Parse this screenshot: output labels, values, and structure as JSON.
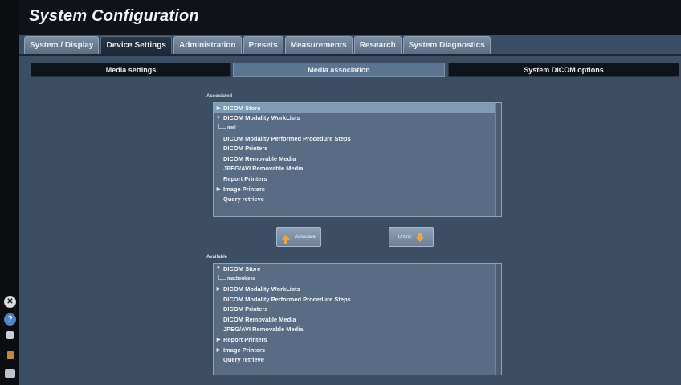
{
  "window": {
    "title": "System Configuration"
  },
  "tabs": [
    {
      "label": "System / Display",
      "active": false
    },
    {
      "label": "Device Settings",
      "active": true
    },
    {
      "label": "Administration",
      "active": false
    },
    {
      "label": "Presets",
      "active": false
    },
    {
      "label": "Measurements",
      "active": false
    },
    {
      "label": "Research",
      "active": false
    },
    {
      "label": "System Diagnostics",
      "active": false
    }
  ],
  "subtabs": [
    {
      "label": "Media settings",
      "active": false
    },
    {
      "label": "Media association",
      "active": true
    },
    {
      "label": "System DICOM options",
      "active": false
    }
  ],
  "associated": {
    "label": "Associated",
    "items": [
      {
        "label": "DICOM Store",
        "expander": "right",
        "selected": true
      },
      {
        "label": "DICOM Modality WorkLists",
        "expander": "down",
        "selected": false
      },
      {
        "label": "mwl",
        "child": true
      },
      {
        "label": "DICOM Modality Performed Procedure Steps"
      },
      {
        "label": "DICOM Printers"
      },
      {
        "label": "DICOM Removable Media"
      },
      {
        "label": "JPEG/AVI Removable Media"
      },
      {
        "label": "Report Printers"
      },
      {
        "label": "Image Printers",
        "expander": "right"
      },
      {
        "label": "Query retrieve"
      }
    ]
  },
  "buttons": {
    "associate_label": "Associate",
    "unlink_label": "Unlink"
  },
  "available": {
    "label": "Available",
    "items": [
      {
        "label": "DICOM Store",
        "expander": "down"
      },
      {
        "label": "macbookjess",
        "child": true
      },
      {
        "label": "DICOM Modality WorkLists",
        "expander": "right"
      },
      {
        "label": "DICOM Modality Performed Procedure Steps"
      },
      {
        "label": "DICOM Printers"
      },
      {
        "label": "DICOM Removable Media"
      },
      {
        "label": "JPEG/AVI Removable Media"
      },
      {
        "label": "Report Printers",
        "expander": "right"
      },
      {
        "label": "Image Printers",
        "expander": "right"
      },
      {
        "label": "Query retrieve"
      }
    ]
  },
  "sidebar_icons": [
    "close-icon",
    "help-icon",
    "print-icon",
    "volume-icon",
    "image-icon"
  ],
  "colors": {
    "accent_orange": "#f2a43a",
    "selected_row": "#7e9bb8",
    "panel_bg": "#3c4e63"
  }
}
